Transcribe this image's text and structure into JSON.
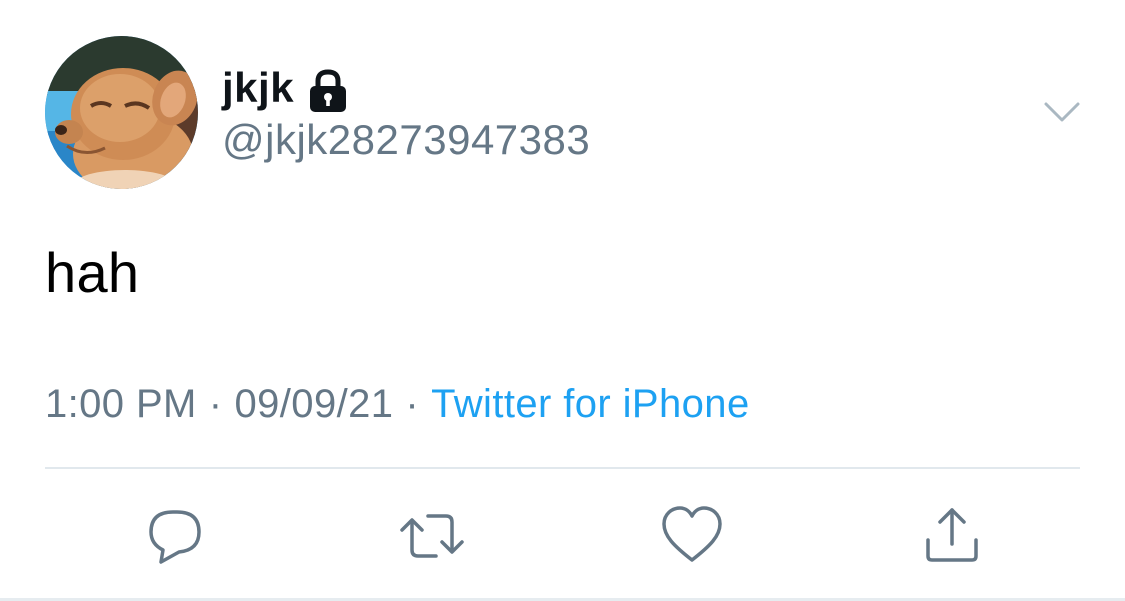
{
  "tweet": {
    "user": {
      "display_name": "jkjk",
      "handle": "@jkjk28273947383",
      "protected_icon": "lock-icon",
      "avatar": "dog-photo"
    },
    "text": "hah",
    "time": "1:00 PM",
    "date": "09/09/21",
    "separator": "·",
    "source": "Twitter for iPhone"
  },
  "colors": {
    "text_primary": "#0f1419",
    "text_secondary": "#657786",
    "link": "#1da1f2",
    "divider": "#e1e8ed",
    "icon": "#657786"
  },
  "actions": {
    "icons": [
      "reply-icon",
      "retweet-icon",
      "like-icon",
      "share-icon"
    ]
  },
  "menu": {
    "icon": "chevron-down-icon"
  }
}
